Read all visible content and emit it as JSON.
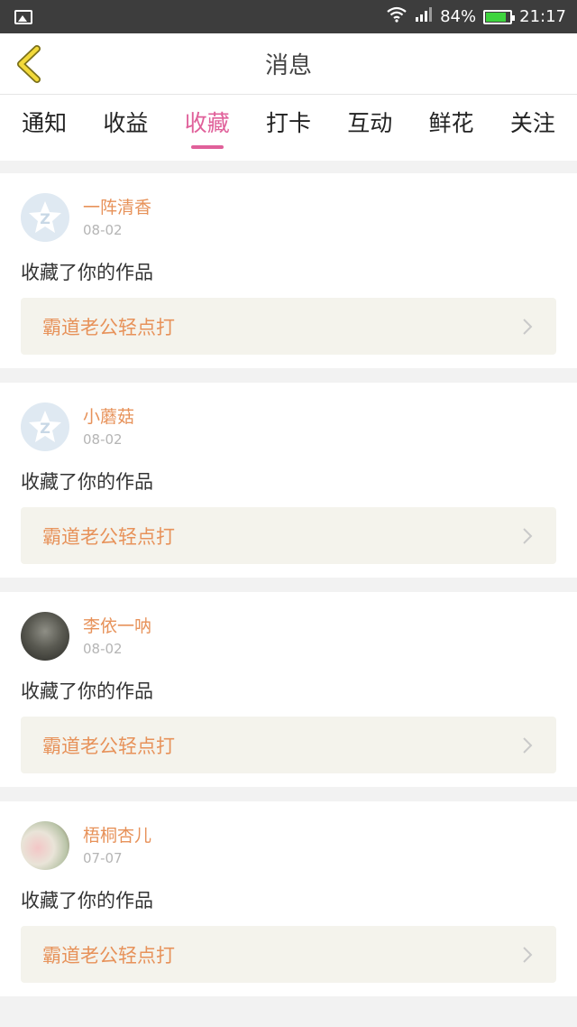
{
  "status_bar": {
    "battery_percent": "84%",
    "battery_level": 0.84,
    "time": "21:17",
    "icons": [
      "image-icon",
      "wifi-icon",
      "signal-icon",
      "battery-icon"
    ]
  },
  "header": {
    "title": "消息",
    "back_icon": "chevron-left-icon"
  },
  "tabs": [
    {
      "label": "通知"
    },
    {
      "label": "收益"
    },
    {
      "label": "收藏",
      "active": true
    },
    {
      "label": "打卡"
    },
    {
      "label": "互动"
    },
    {
      "label": "鲜花"
    },
    {
      "label": "关注"
    }
  ],
  "colors": {
    "accent": "#e0609a",
    "name": "#e7925a",
    "link_bg": "#f4f3ec"
  },
  "items": [
    {
      "username": "一阵清香",
      "date": "08-02",
      "action": "收藏了你的作品",
      "work_title": "霸道老公轻点打",
      "avatar": "default-avatar-icon"
    },
    {
      "username": "小蘑菇",
      "date": "08-02",
      "action": "收藏了你的作品",
      "work_title": "霸道老公轻点打",
      "avatar": "default-avatar-icon"
    },
    {
      "username": "李依一呐",
      "date": "08-02",
      "action": "收藏了你的作品",
      "work_title": "霸道老公轻点打",
      "avatar": "photo-avatar"
    },
    {
      "username": "梧桐杏儿",
      "date": "07-07",
      "action": "收藏了你的作品",
      "work_title": "霸道老公轻点打",
      "avatar": "photo-avatar"
    }
  ]
}
